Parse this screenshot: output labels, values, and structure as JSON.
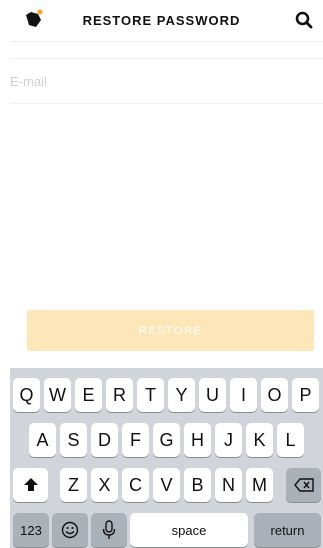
{
  "header": {
    "title": "RESTORE PASSWORD",
    "logo_icon": "cat-logo-icon",
    "search_icon": "search-icon",
    "accent": "#f5a623"
  },
  "form": {
    "email_placeholder": "E-mail",
    "email_value": ""
  },
  "restore_button": {
    "label": "RESTORE",
    "color": "#fde7b8"
  },
  "keyboard": {
    "row1": [
      "Q",
      "W",
      "E",
      "R",
      "T",
      "Y",
      "U",
      "I",
      "O",
      "P"
    ],
    "row2": [
      "A",
      "S",
      "D",
      "F",
      "G",
      "H",
      "J",
      "K",
      "L"
    ],
    "row3": [
      "Z",
      "X",
      "C",
      "V",
      "B",
      "N",
      "M"
    ],
    "numbers_label": "123",
    "space_label": "space",
    "return_label": "return",
    "shift_icon": "shift-icon",
    "delete_icon": "delete-icon",
    "emoji_icon": "emoji-icon",
    "mic_icon": "microphone-icon"
  }
}
